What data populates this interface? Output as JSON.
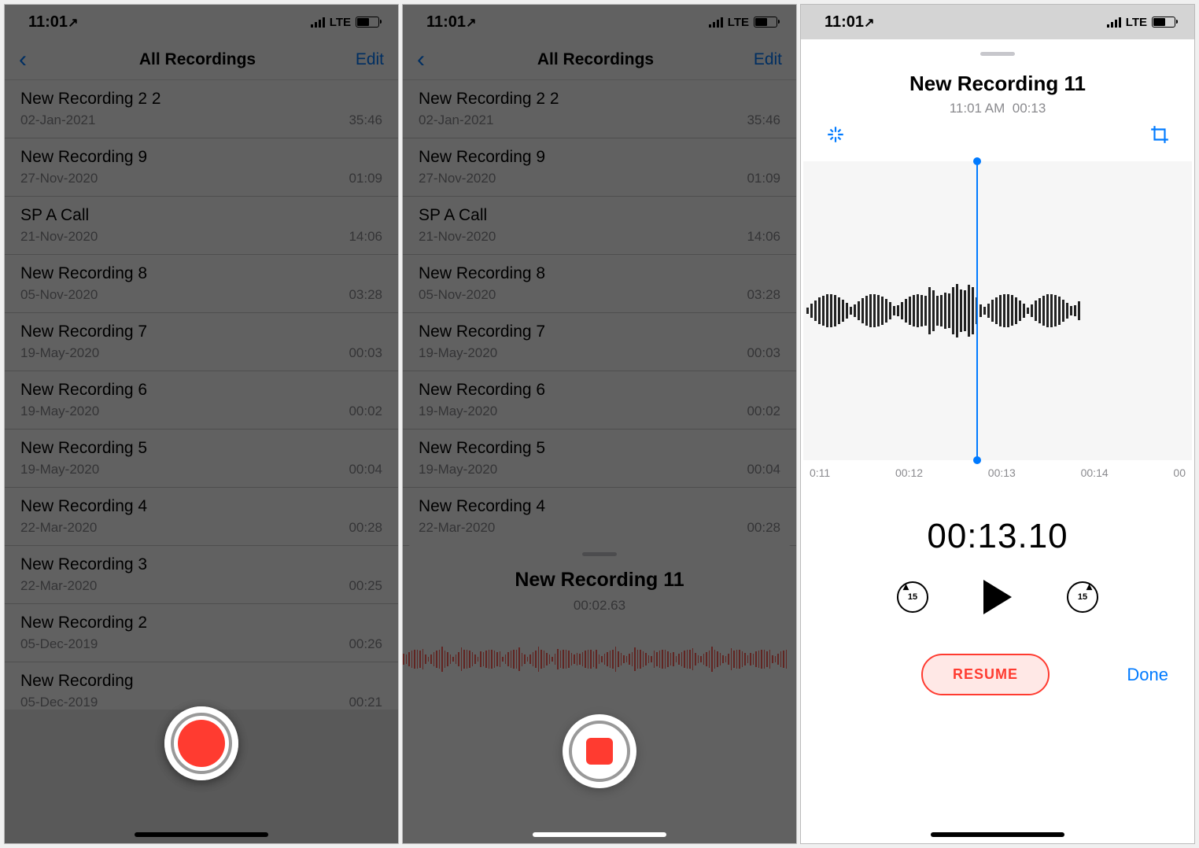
{
  "statusBar": {
    "time": "11:01",
    "carrier": "LTE"
  },
  "panel1": {
    "navTitle": "All Recordings",
    "editLabel": "Edit",
    "recordings": [
      {
        "name": "New Recording 2 2",
        "date": "02-Jan-2021",
        "duration": "35:46"
      },
      {
        "name": "New Recording 9",
        "date": "27-Nov-2020",
        "duration": "01:09"
      },
      {
        "name": "SP A Call",
        "date": "21-Nov-2020",
        "duration": "14:06"
      },
      {
        "name": "New Recording 8",
        "date": "05-Nov-2020",
        "duration": "03:28"
      },
      {
        "name": "New Recording 7",
        "date": "19-May-2020",
        "duration": "00:03"
      },
      {
        "name": "New Recording 6",
        "date": "19-May-2020",
        "duration": "00:02"
      },
      {
        "name": "New Recording 5",
        "date": "19-May-2020",
        "duration": "00:04"
      },
      {
        "name": "New Recording 4",
        "date": "22-Mar-2020",
        "duration": "00:28"
      },
      {
        "name": "New Recording 3",
        "date": "22-Mar-2020",
        "duration": "00:25"
      },
      {
        "name": "New Recording 2",
        "date": "05-Dec-2019",
        "duration": "00:26"
      },
      {
        "name": "New Recording",
        "date": "05-Dec-2019",
        "duration": "00:21"
      }
    ]
  },
  "panel2": {
    "navTitle": "All Recordings",
    "editLabel": "Edit",
    "sheetTitle": "New Recording 11",
    "sheetTime": "00:02.63"
  },
  "panel3": {
    "title": "New Recording 11",
    "subTime": "11:01 AM",
    "subDuration": "00:13",
    "ruler": [
      "0:11",
      "00:12",
      "00:13",
      "00:14",
      "00"
    ],
    "bigTime": "00:13.10",
    "skipSeconds": "15",
    "resumeLabel": "RESUME",
    "doneLabel": "Done"
  }
}
